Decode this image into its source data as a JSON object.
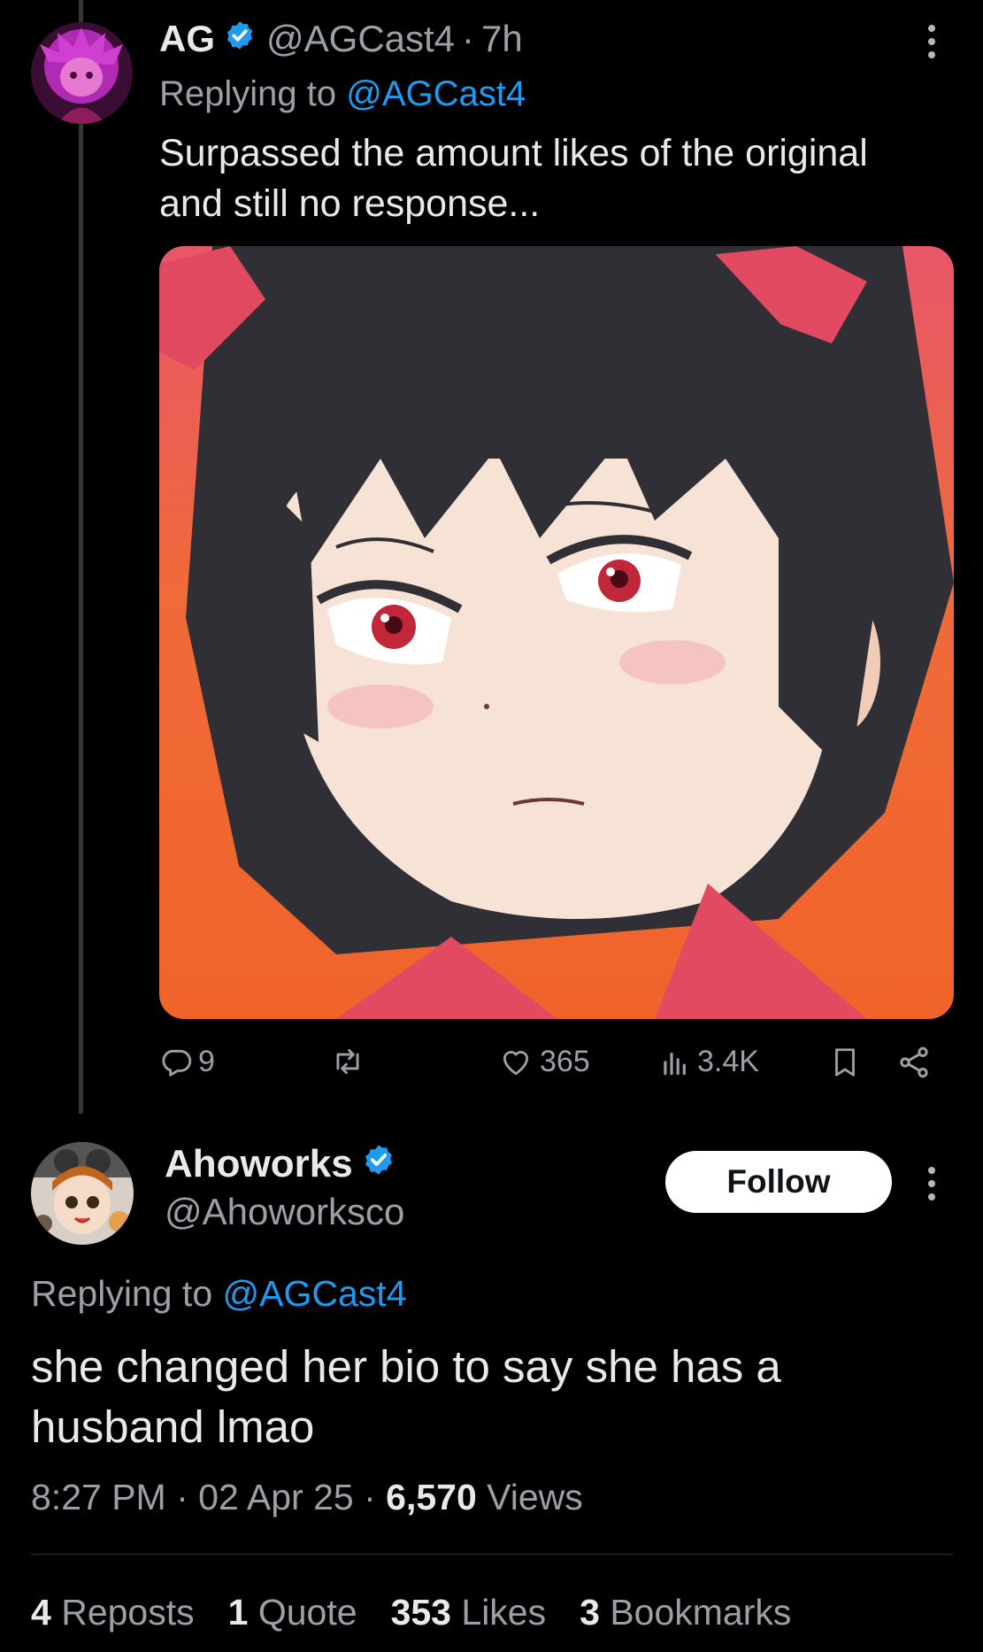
{
  "tweet1": {
    "display_name": "AG",
    "handle": "@AGCast4",
    "time": "7h",
    "replying_prefix": "Replying to",
    "replying_to": "@AGCast4",
    "text_line1": "Surpassed the amount likes of the original",
    "text_line2": "and still no response...",
    "actions": {
      "replies": "9",
      "reposts": "",
      "likes": "365",
      "views": "3.4K"
    }
  },
  "tweet2": {
    "display_name": "Ahoworks",
    "handle": "@Ahoworksco",
    "follow_label": "Follow",
    "replying_prefix": "Replying to",
    "replying_to": "@AGCast4",
    "text_line1": "she changed her bio to say she has a",
    "text_line2": "husband lmao",
    "time": "8:27 PM",
    "date": "02 Apr 25",
    "views_count": "6,570",
    "views_label": "Views",
    "stats": {
      "reposts_count": "4",
      "reposts_label": "Reposts",
      "quote_count": "1",
      "quote_label": "Quote",
      "likes_count": "353",
      "likes_label": "Likes",
      "bookmarks_count": "3",
      "bookmarks_label": "Bookmarks"
    }
  },
  "icons": {
    "reply": "reply-icon",
    "repost": "repost-icon",
    "like": "heart-icon",
    "views": "views-icon",
    "bookmark": "bookmark-icon",
    "share": "share-icon",
    "verified": "verified-badge-icon",
    "more": "more-icon"
  },
  "colors": {
    "background": "#000000",
    "text": "#e7e9ea",
    "secondary": "#9aa0a6",
    "link": "#1d9bf0",
    "verified": "#1d9bf0",
    "follow_bg": "#ffffff"
  }
}
